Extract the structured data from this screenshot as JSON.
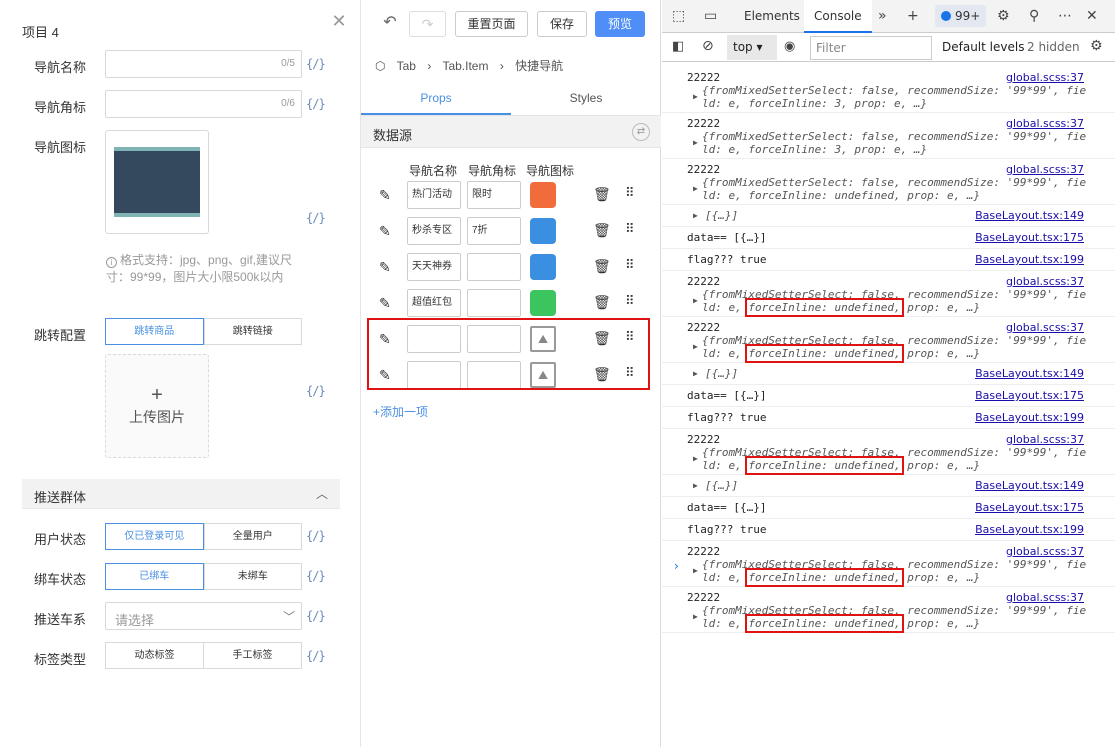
{
  "left": {
    "title": "项目 4",
    "fields": {
      "nav_name_label": "导航名称",
      "nav_name_count": "0/5",
      "nav_badge_label": "导航角标",
      "nav_badge_count": "0/6",
      "nav_icon_label": "导航图标",
      "var_btn": "{/}",
      "hint": "格式支持：jpg、png、gif,建议尺寸：99*99，图片大小限500k以内",
      "jump_label": "跳转配置",
      "jump_opts": [
        "跳转商品",
        "跳转链接"
      ],
      "upload_label": "上传图片",
      "push_section": "推送群体",
      "user_status_label": "用户状态",
      "user_status_opts": [
        "仅已登录可见",
        "全量用户"
      ],
      "bind_status_label": "绑车状态",
      "bind_status_opts": [
        "已绑车",
        "未绑车"
      ],
      "push_car_label": "推送车系",
      "push_car_placeholder": "请选择",
      "tag_type_label": "标签类型",
      "tag_type_opts": [
        "动态标签",
        "手工标签"
      ]
    }
  },
  "mid": {
    "toolbar": {
      "reset": "重置页面",
      "save": "保存",
      "preview": "预览"
    },
    "breadcrumb": [
      "Tab",
      "Tab.Item",
      "快捷导航"
    ],
    "tabs": [
      "Props",
      "Styles"
    ],
    "datasource": "数据源",
    "columns": [
      "导航名称",
      "导航角标",
      "导航图标"
    ],
    "rows": [
      {
        "name": "热门活动",
        "badge": "限时",
        "icon_color": "#f26b3a"
      },
      {
        "name": "秒杀专区",
        "badge": "7折",
        "icon_color": "#3b8fe0"
      },
      {
        "name": "天天神券",
        "badge": "",
        "icon_color": "#3b8fe0"
      },
      {
        "name": "超值红包",
        "badge": "",
        "icon_color": "#3cc45f"
      },
      {
        "name": "",
        "badge": "",
        "icon_color": ""
      },
      {
        "name": "",
        "badge": "",
        "icon_color": ""
      }
    ],
    "add_item": "+添加一项"
  },
  "devtools": {
    "tabs": [
      "Elements",
      "Console"
    ],
    "badge": "99+",
    "context": "top",
    "filter_placeholder": "Filter",
    "levels": "Default levels",
    "hidden": "2 hidden",
    "messages": [
      {
        "text": "22222",
        "src": "global.scss:37",
        "obj1": "{fromMixedSetterSelect: false, recommendSize: '99*99', fie",
        "obj2": "ld: e, forceInline: 3, prop: e, …}"
      },
      {
        "text": "22222",
        "src": "global.scss:37",
        "obj1": "{fromMixedSetterSelect: false, recommendSize: '99*99', fie",
        "obj2": "ld: e, forceInline: 3, prop: e, …}"
      },
      {
        "text": "22222",
        "src": "global.scss:37",
        "obj1": "{fromMixedSetterSelect: false, recommendSize: '99*99', fie",
        "obj2": "ld: e, forceInline: undefined, prop: e, …}"
      },
      {
        "text": "[{…}]",
        "src": "BaseLayout.tsx:149"
      },
      {
        "text": "data== [{…}]",
        "src": "BaseLayout.tsx:175"
      },
      {
        "text": "flag??? true",
        "src": "BaseLayout.tsx:199"
      },
      {
        "text": "22222",
        "src": "global.scss:37",
        "obj1": "{fromMixedSetterSelect: false, recommendSize: '99*99', fie",
        "obj2": "ld: e, forceInline: undefined, prop: e, …}"
      },
      {
        "text": "22222",
        "src": "global.scss:37",
        "obj1": "{fromMixedSetterSelect: false, recommendSize: '99*99', fie",
        "obj2": "ld: e, forceInline: undefined, prop: e, …}"
      },
      {
        "text": "[{…}]",
        "src": "BaseLayout.tsx:149"
      },
      {
        "text": "data== [{…}]",
        "src": "BaseLayout.tsx:175"
      },
      {
        "text": "flag??? true",
        "src": "BaseLayout.tsx:199"
      },
      {
        "text": "22222",
        "src": "global.scss:37",
        "obj1": "{fromMixedSetterSelect: false, recommendSize: '99*99', fie",
        "obj2": "ld: e, forceInline: undefined, prop: e, …}"
      },
      {
        "text": "[{…}]",
        "src": "BaseLayout.tsx:149"
      },
      {
        "text": "data== [{…}]",
        "src": "BaseLayout.tsx:175"
      },
      {
        "text": "flag??? true",
        "src": "BaseLayout.tsx:199"
      },
      {
        "text": "22222",
        "src": "global.scss:37",
        "obj1": "{fromMixedSetterSelect: false, recommendSize: '99*99', fie",
        "obj2": "ld: e, forceInline: undefined, prop: e, …}"
      },
      {
        "text": "22222",
        "src": "global.scss:37",
        "obj1": "{fromMixedSetterSelect: false, recommendSize: '99*99', fie",
        "obj2": "ld: e, forceInline: undefined, prop: e, …}"
      }
    ]
  }
}
